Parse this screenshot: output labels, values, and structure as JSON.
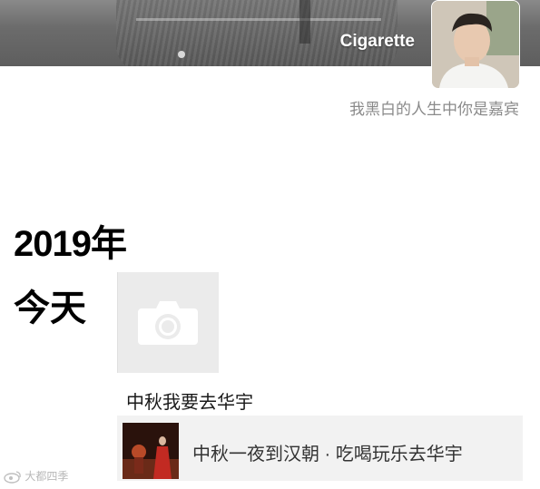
{
  "profile": {
    "username": "Cigarette",
    "signature": "我黑白的人生中你是嘉宾"
  },
  "timeline": {
    "year": "2019年",
    "day_label": "今天",
    "post": {
      "text": "中秋我要去华宇",
      "link_title": "中秋一夜到汉朝 · 吃喝玩乐去华宇"
    }
  },
  "watermark": {
    "text": "大都四季"
  },
  "icons": {
    "camera": "camera-icon",
    "avatar": "avatar-photo",
    "thumbnail": "link-thumbnail"
  },
  "colors": {
    "signature_text": "#8a8a8a",
    "card_background": "#f2f2f2",
    "placeholder_background": "#ebebeb"
  }
}
